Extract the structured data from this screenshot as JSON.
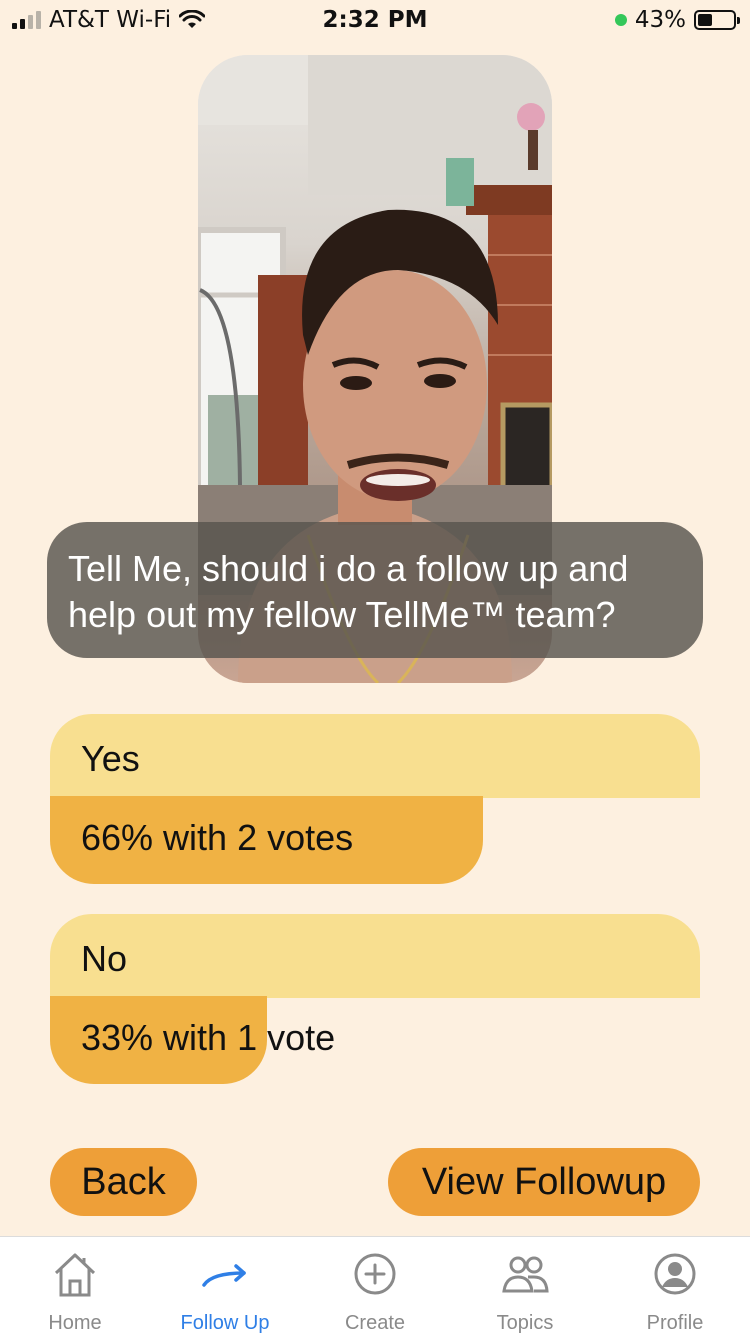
{
  "status_bar": {
    "carrier": "AT&T Wi-Fi",
    "time": "2:32 PM",
    "battery": "43%",
    "battery_level": 0.43
  },
  "question": {
    "text": "Tell Me, should i do a follow up and help out my fellow TellMe™ team?"
  },
  "poll": {
    "options": [
      {
        "label": "Yes",
        "result": "66% with 2 votes",
        "percent": 66
      },
      {
        "label": "No",
        "result": "33% with 1 vote",
        "percent": 33
      }
    ]
  },
  "buttons": {
    "back": "Back",
    "view_followup": "View Followup"
  },
  "tabs": [
    {
      "label": "Home",
      "icon": "home-icon",
      "active": false
    },
    {
      "label": "Follow Up",
      "icon": "arrow-right-icon",
      "active": true
    },
    {
      "label": "Create",
      "icon": "plus-circle-icon",
      "active": false
    },
    {
      "label": "Topics",
      "icon": "people-icon",
      "active": false
    },
    {
      "label": "Profile",
      "icon": "profile-icon",
      "active": false
    }
  ],
  "colors": {
    "background": "#fdf0e0",
    "option_light": "#f8df90",
    "option_bar": "#f0b244",
    "button": "#ee9f38",
    "active_tab": "#2f7fe6"
  }
}
